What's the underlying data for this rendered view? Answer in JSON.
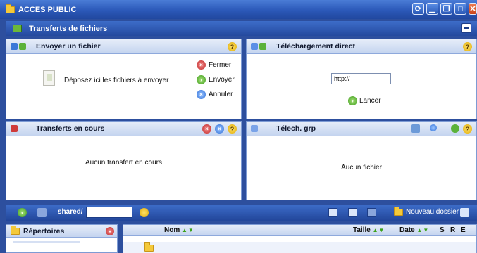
{
  "window": {
    "title": "ACCES PUBLIC"
  },
  "subheader": {
    "title": "Transferts de fichiers"
  },
  "upload_panel": {
    "title": "Envoyer un fichier",
    "drop_text": "Déposez ici les fichiers à envoyer",
    "actions": {
      "close": "Fermer",
      "send": "Envoyer",
      "cancel": "Annuler"
    }
  },
  "direct_download_panel": {
    "title": "Téléchargement direct",
    "url_value": "http://",
    "launch": "Lancer"
  },
  "transfers_panel": {
    "title": "Transferts en cours",
    "empty_message": "Aucun transfert en cours"
  },
  "group_download_panel": {
    "title": "Télech. grp",
    "empty_message": "Aucun fichier"
  },
  "bottom_toolbar": {
    "path": "shared/",
    "path_input": "",
    "new_folder": "Nouveau dossier"
  },
  "directories_panel": {
    "title": "Répertoires"
  },
  "file_list": {
    "columns": {
      "name": "Nom",
      "size": "Taille",
      "date": "Date",
      "s": "S",
      "r": "R",
      "e": "E"
    }
  },
  "colors": {
    "window_blue": "#2d4f9e",
    "header_blue": "#3d6dc9",
    "panel_header": "#c4d4ef"
  }
}
